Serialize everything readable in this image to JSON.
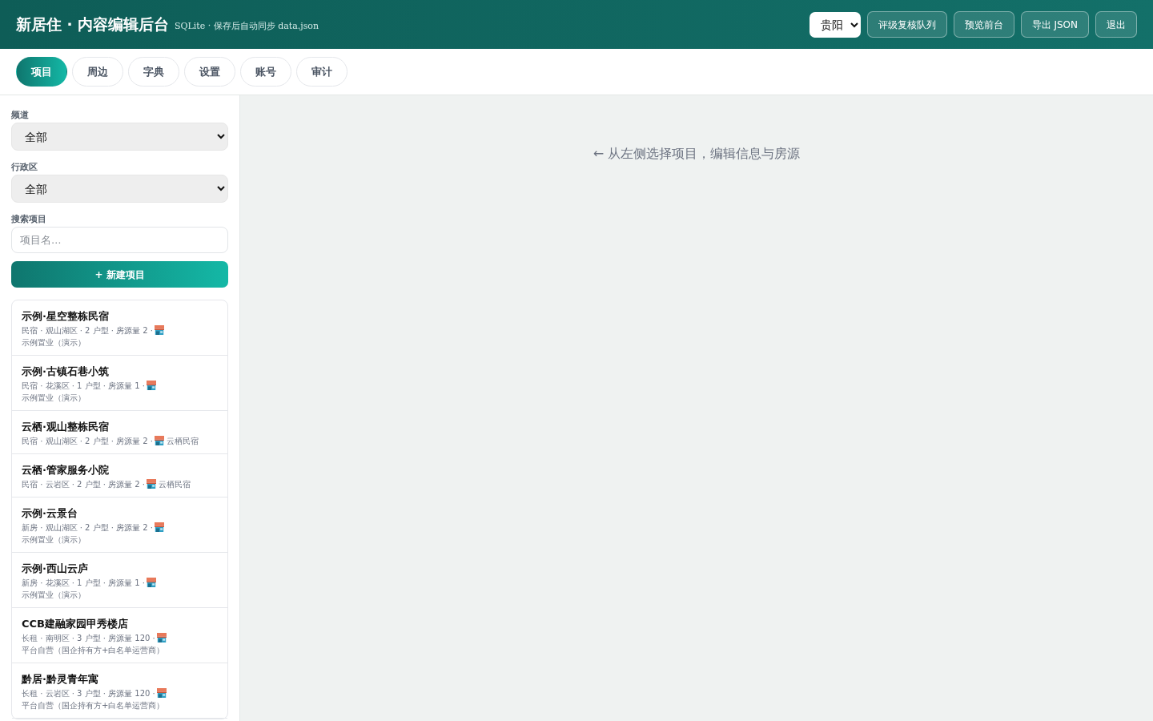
{
  "header": {
    "title": "新居住 · 内容编辑后台",
    "subtitle": "SQLite · 保存后自动同步 data.json",
    "city": "贵阳",
    "buttons": [
      "评级复核队列",
      "预览前台",
      "导出 JSON",
      "退出"
    ]
  },
  "tabs": [
    {
      "label": "项目",
      "selected": true
    },
    {
      "label": "周边",
      "selected": false
    },
    {
      "label": "字典",
      "selected": false
    },
    {
      "label": "设置",
      "selected": false
    },
    {
      "label": "账号",
      "selected": false
    },
    {
      "label": "审计",
      "selected": false
    }
  ],
  "sidebar": {
    "filters": [
      {
        "label": "频道",
        "value": "全部"
      },
      {
        "label": "行政区",
        "value": "全部"
      }
    ],
    "search": {
      "label": "搜索项目",
      "placeholder": "项目名…"
    },
    "new_button": "+ 新建项目",
    "items": [
      {
        "name": "示例·星空整栋民宿",
        "meta": "民宿 · 观山湖区 · 2 户型 · 房源量 2 ·",
        "owner": "示例置业（演示）"
      },
      {
        "name": "示例·古镇石巷小筑",
        "meta": "民宿 · 花溪区 · 1 户型 · 房源量 1 ·",
        "owner": "示例置业（演示）"
      },
      {
        "name": "云栖·观山整栋民宿",
        "meta": "民宿 · 观山湖区 · 2 户型 · 房源量 2 ·",
        "owner": "云栖民宿"
      },
      {
        "name": "云栖·管家服务小院",
        "meta": "民宿 · 云岩区 · 2 户型 · 房源量 2 ·",
        "owner": "云栖民宿"
      },
      {
        "name": "示例·云景台",
        "meta": "新房 · 观山湖区 · 2 户型 · 房源量 2 ·",
        "owner": "示例置业（演示）"
      },
      {
        "name": "示例·西山云庐",
        "meta": "新房 · 花溪区 · 1 户型 · 房源量 1 ·",
        "owner": "示例置业（演示）"
      },
      {
        "name": "CCB建融家园甲秀楼店",
        "meta": "长租 · 南明区 · 3 户型 · 房源量 120 ·",
        "owner": "平台自营（国企持有方+白名单运营商）"
      },
      {
        "name": "黔居·黔灵青年寓",
        "meta": "长租 · 云岩区 · 3 户型 · 房源量 120 ·",
        "owner": "平台自营（国企持有方+白名单运营商）"
      }
    ]
  },
  "main": {
    "hint": "← 从左侧选择项目，编辑信息与房源"
  }
}
